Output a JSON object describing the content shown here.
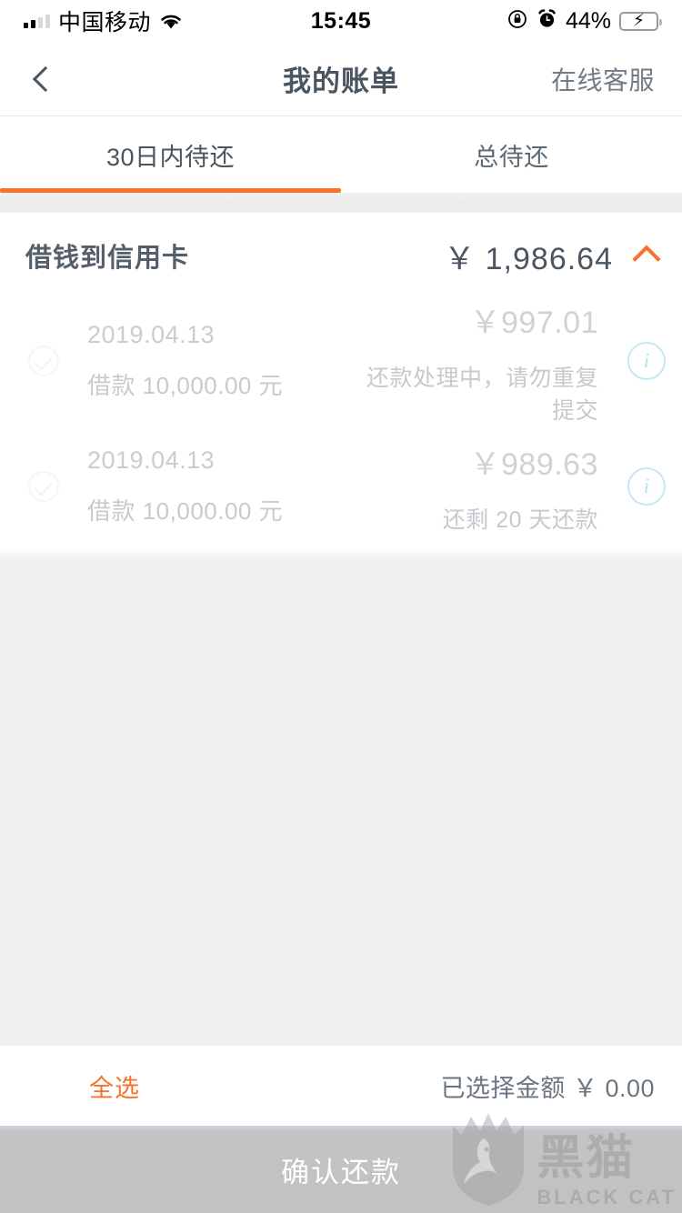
{
  "status_bar": {
    "carrier": "中国移动",
    "time": "15:45",
    "battery_pct": "44%",
    "signal_bars_filled": 2,
    "icons": [
      "signal-bars-icon",
      "wifi-icon",
      "rotation-lock-icon",
      "alarm-clock-icon",
      "battery-charging-icon"
    ]
  },
  "nav": {
    "back_icon": "chevron-left-icon",
    "title": "我的账单",
    "action_label": "在线客服"
  },
  "tabs": {
    "items": [
      {
        "label": "30日内待还",
        "active": true
      },
      {
        "label": "总待还",
        "active": false
      }
    ],
    "indicator_color": "#f9712c"
  },
  "bill_group": {
    "title": "借钱到信用卡",
    "total": "￥ 1,986.64",
    "collapse_icon": "chevron-up-icon",
    "rows": [
      {
        "date": "2019.04.13",
        "principal": "借款 10,000.00 元",
        "amount": "￥997.01",
        "status": "还款处理中，请勿重复提交",
        "info_icon": "info-circle-icon",
        "checkbox_icon": "check-circle-icon"
      },
      {
        "date": "2019.04.13",
        "principal": "借款 10,000.00 元",
        "amount": "￥989.63",
        "status": "还剩 20 天还款",
        "info_icon": "info-circle-icon",
        "checkbox_icon": "check-circle-icon"
      }
    ]
  },
  "footer": {
    "select_all_label": "全选",
    "selected_amount_label": "已选择金额 ￥ 0.00",
    "confirm_label": "确认还款"
  },
  "watermark": {
    "cn": "黑猫",
    "en": "BLACK CAT",
    "shield_icon": "black-cat-shield-icon"
  },
  "colors": {
    "accent": "#f9712c",
    "title_text": "#4a5560",
    "muted_text": "#c9ccd1",
    "info_icon": "#b7e3ef",
    "battery_green": "#33d15f"
  }
}
